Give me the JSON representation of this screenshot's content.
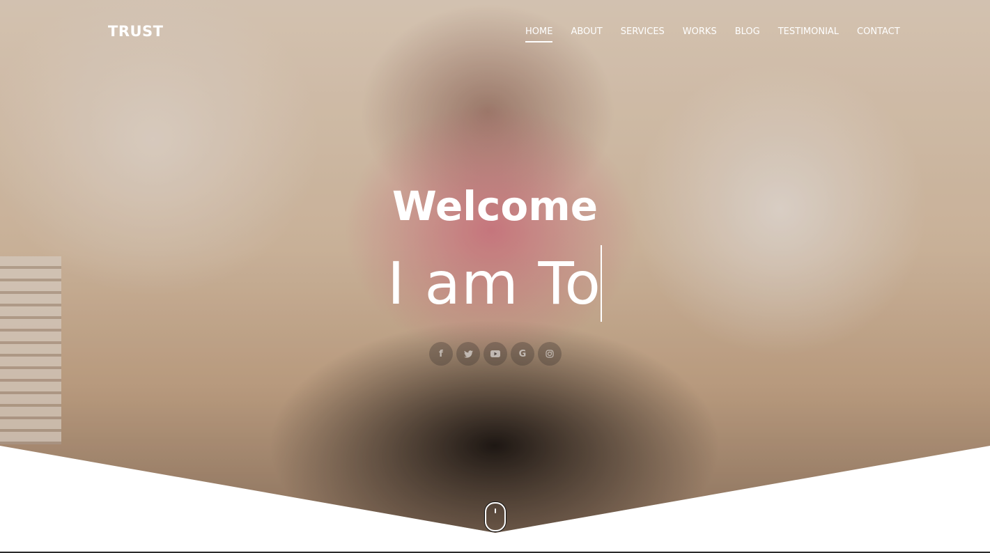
{
  "brand": {
    "logo": "TRUST"
  },
  "nav": {
    "items": [
      {
        "label": "HOME",
        "active": true
      },
      {
        "label": "ABOUT",
        "active": false
      },
      {
        "label": "SERVICES",
        "active": false
      },
      {
        "label": "WORKS",
        "active": false
      },
      {
        "label": "BLOG",
        "active": false
      },
      {
        "label": "TESTIMONIAL",
        "active": false
      },
      {
        "label": "CONTACT",
        "active": false
      }
    ]
  },
  "hero": {
    "welcome": "Welcome",
    "typed_text": "I am To"
  },
  "socials": {
    "items": [
      {
        "icon": "facebook-icon",
        "glyph": "f"
      },
      {
        "icon": "twitter-icon",
        "glyph": "🐦"
      },
      {
        "icon": "youtube-icon",
        "glyph": "▶"
      },
      {
        "icon": "google-icon",
        "glyph": "G"
      },
      {
        "icon": "instagram-icon",
        "glyph": "◎"
      }
    ]
  },
  "scroll_indicator": {
    "icon": "mouse-scroll-icon"
  },
  "colors": {
    "text": "#ffffff",
    "background": "#ffffff"
  }
}
